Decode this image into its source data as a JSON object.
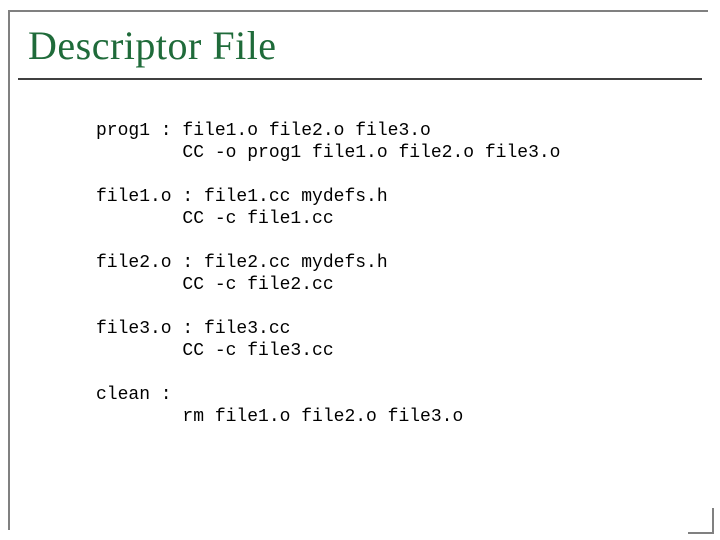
{
  "title": "Descriptor File",
  "code": {
    "l1": "prog1 : file1.o file2.o file3.o",
    "l2": "        CC -o prog1 file1.o file2.o file3.o",
    "l3": "",
    "l4": "file1.o : file1.cc mydefs.h",
    "l5": "        CC -c file1.cc",
    "l6": "",
    "l7": "file2.o : file2.cc mydefs.h",
    "l8": "        CC -c file2.cc",
    "l9": "",
    "l10": "file3.o : file3.cc",
    "l11": "        CC -c file3.cc",
    "l12": "",
    "l13": "clean :",
    "l14": "        rm file1.o file2.o file3.o"
  }
}
